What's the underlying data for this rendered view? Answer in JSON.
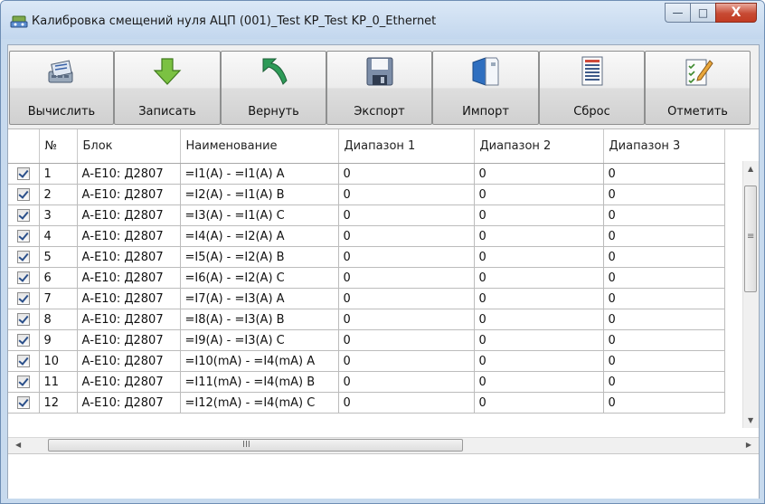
{
  "window": {
    "title": "Калибровка смещений нуля АЦП (001)_Test KP_Test KP_0_Ethernet",
    "buttons": {
      "minimize": "—",
      "maximize": "□",
      "close": "X"
    }
  },
  "toolbar": {
    "buttons": [
      {
        "id": "calc",
        "label": "Вычислить",
        "icon": "calculator-icon"
      },
      {
        "id": "write",
        "label": "Записать",
        "icon": "down-arrow-icon"
      },
      {
        "id": "revert",
        "label": "Вернуть",
        "icon": "undo-arrow-icon"
      },
      {
        "id": "export",
        "label": "Экспорт",
        "icon": "floppy-disk-icon"
      },
      {
        "id": "import",
        "label": "Импорт",
        "icon": "import-document-icon"
      },
      {
        "id": "reset",
        "label": "Сброс",
        "icon": "list-document-icon"
      },
      {
        "id": "mark",
        "label": "Отметить",
        "icon": "checklist-pencil-icon"
      }
    ]
  },
  "grid": {
    "columns": [
      "",
      "№",
      "Блок",
      "Наименование",
      "Диапазон 1",
      "Диапазон 2",
      "Диапазон 3"
    ],
    "rows": [
      {
        "checked": true,
        "num": "1",
        "block": "А-Е10: Д2807",
        "name": "=I1(A) - =I1(A) A",
        "r1": "0",
        "r2": "0",
        "r3": "0"
      },
      {
        "checked": true,
        "num": "2",
        "block": "А-Е10: Д2807",
        "name": "=I2(A) - =I1(A) B",
        "r1": "0",
        "r2": "0",
        "r3": "0"
      },
      {
        "checked": true,
        "num": "3",
        "block": "А-Е10: Д2807",
        "name": "=I3(A) - =I1(A) C",
        "r1": "0",
        "r2": "0",
        "r3": "0"
      },
      {
        "checked": true,
        "num": "4",
        "block": "А-Е10: Д2807",
        "name": "=I4(A) - =I2(A) A",
        "r1": "0",
        "r2": "0",
        "r3": "0"
      },
      {
        "checked": true,
        "num": "5",
        "block": "А-Е10: Д2807",
        "name": "=I5(A) - =I2(A) B",
        "r1": "0",
        "r2": "0",
        "r3": "0"
      },
      {
        "checked": true,
        "num": "6",
        "block": "А-Е10: Д2807",
        "name": "=I6(A) - =I2(A) C",
        "r1": "0",
        "r2": "0",
        "r3": "0"
      },
      {
        "checked": true,
        "num": "7",
        "block": "А-Е10: Д2807",
        "name": "=I7(A) - =I3(A) A",
        "r1": "0",
        "r2": "0",
        "r3": "0"
      },
      {
        "checked": true,
        "num": "8",
        "block": "А-Е10: Д2807",
        "name": "=I8(A) - =I3(A) B",
        "r1": "0",
        "r2": "0",
        "r3": "0"
      },
      {
        "checked": true,
        "num": "9",
        "block": "А-Е10: Д2807",
        "name": "=I9(A) - =I3(A) C",
        "r1": "0",
        "r2": "0",
        "r3": "0"
      },
      {
        "checked": true,
        "num": "10",
        "block": "А-Е10: Д2807",
        "name": "=I10(mA) - =I4(mA) A",
        "r1": "0",
        "r2": "0",
        "r3": "0"
      },
      {
        "checked": true,
        "num": "11",
        "block": "А-Е10: Д2807",
        "name": "=I11(mA) - =I4(mA) B",
        "r1": "0",
        "r2": "0",
        "r3": "0"
      },
      {
        "checked": true,
        "num": "12",
        "block": "А-Е10: Д2807",
        "name": "=I12(mA) - =I4(mA) C",
        "r1": "0",
        "r2": "0",
        "r3": "0"
      }
    ]
  },
  "scroll": {
    "hthumb_grip": "III",
    "vthumb_grip": "≡"
  }
}
